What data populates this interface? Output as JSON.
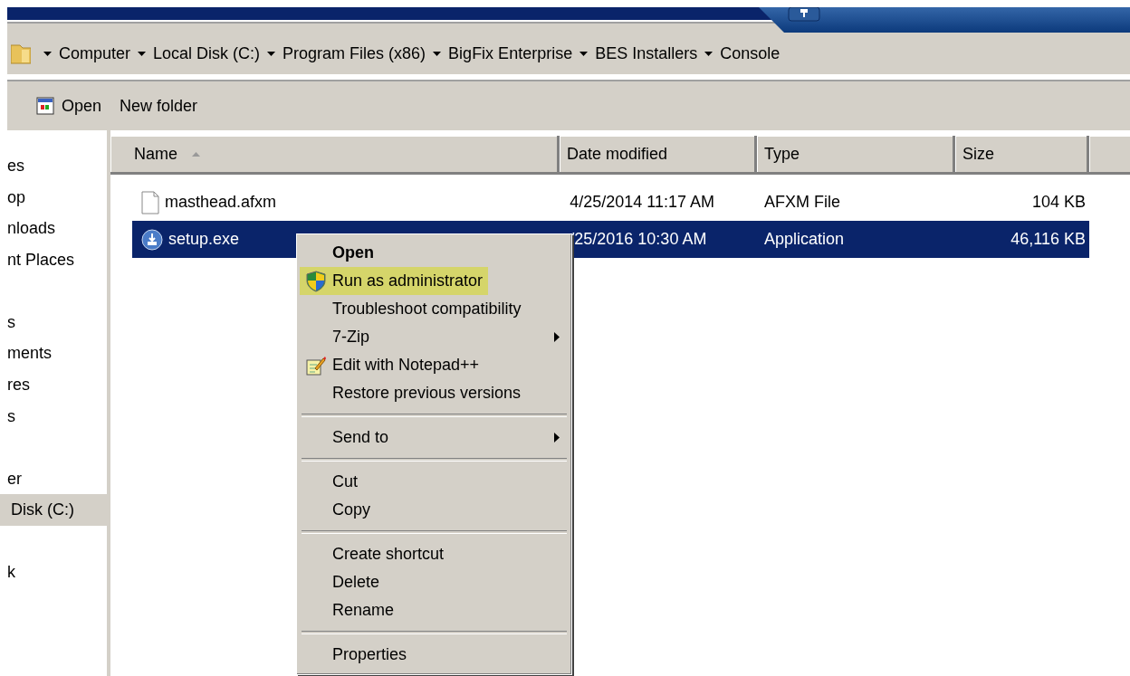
{
  "address_bar": {
    "crumbs": [
      "Computer",
      "Local Disk (C:)",
      "Program Files (x86)",
      "BigFix Enterprise",
      "BES Installers",
      "Console"
    ]
  },
  "toolbar": {
    "buttons": [
      {
        "label": "Open",
        "kind": "open"
      },
      {
        "label": "New folder",
        "kind": "plain"
      }
    ]
  },
  "sidebar": {
    "items": [
      {
        "label": "es",
        "selected": false
      },
      {
        "label": "op",
        "selected": false
      },
      {
        "label": "nloads",
        "selected": false
      },
      {
        "label": "nt Places",
        "selected": false
      },
      {
        "label": "s",
        "selected": false
      },
      {
        "label": "ments",
        "selected": false
      },
      {
        "label": "res",
        "selected": false
      },
      {
        "label": "s",
        "selected": false
      },
      {
        "label": "er",
        "selected": false
      },
      {
        "label": "Disk (C:)",
        "selected": true
      },
      {
        "label": "k",
        "selected": false
      }
    ]
  },
  "table": {
    "columns": [
      {
        "label": "Name",
        "sorted": true
      },
      {
        "label": "Date modified",
        "sorted": false
      },
      {
        "label": "Type",
        "sorted": false
      },
      {
        "label": "Size",
        "sorted": false
      }
    ],
    "rows": [
      {
        "kind": "document",
        "name": "masthead.afxm",
        "date": "4/25/2014 11:17 AM",
        "type": "AFXM File",
        "size": "104 KB",
        "selected": false
      },
      {
        "kind": "installer",
        "name": "setup.exe",
        "date": "/25/2016 10:30 AM",
        "type": "Application",
        "size": "46,116 KB",
        "selected": true
      }
    ]
  },
  "context_menu": {
    "items": [
      {
        "kind": "default",
        "label": "Open",
        "selected": false
      },
      {
        "kind": "elevated",
        "label": "Run as administrator",
        "selected": true
      },
      {
        "kind": "plain",
        "label": "Troubleshoot compatibility",
        "selected": false
      },
      {
        "kind": "submenu",
        "label": "7-Zip",
        "selected": false
      },
      {
        "kind": "editor",
        "label": "Edit with Notepad++",
        "selected": false
      },
      {
        "kind": "plain",
        "label": "Restore previous versions",
        "selected": false
      },
      {
        "kind": "separator"
      },
      {
        "kind": "submenu",
        "label": "Send to",
        "selected": false
      },
      {
        "kind": "separator"
      },
      {
        "kind": "plain",
        "label": "Cut",
        "selected": false
      },
      {
        "kind": "plain",
        "label": "Copy",
        "selected": false
      },
      {
        "kind": "separator"
      },
      {
        "kind": "plain",
        "label": "Create shortcut",
        "selected": false
      },
      {
        "kind": "plain",
        "label": "Delete",
        "selected": false
      },
      {
        "kind": "plain",
        "label": "Rename",
        "selected": false
      },
      {
        "kind": "separator"
      },
      {
        "kind": "plain",
        "label": "Properties",
        "selected": false
      }
    ]
  }
}
